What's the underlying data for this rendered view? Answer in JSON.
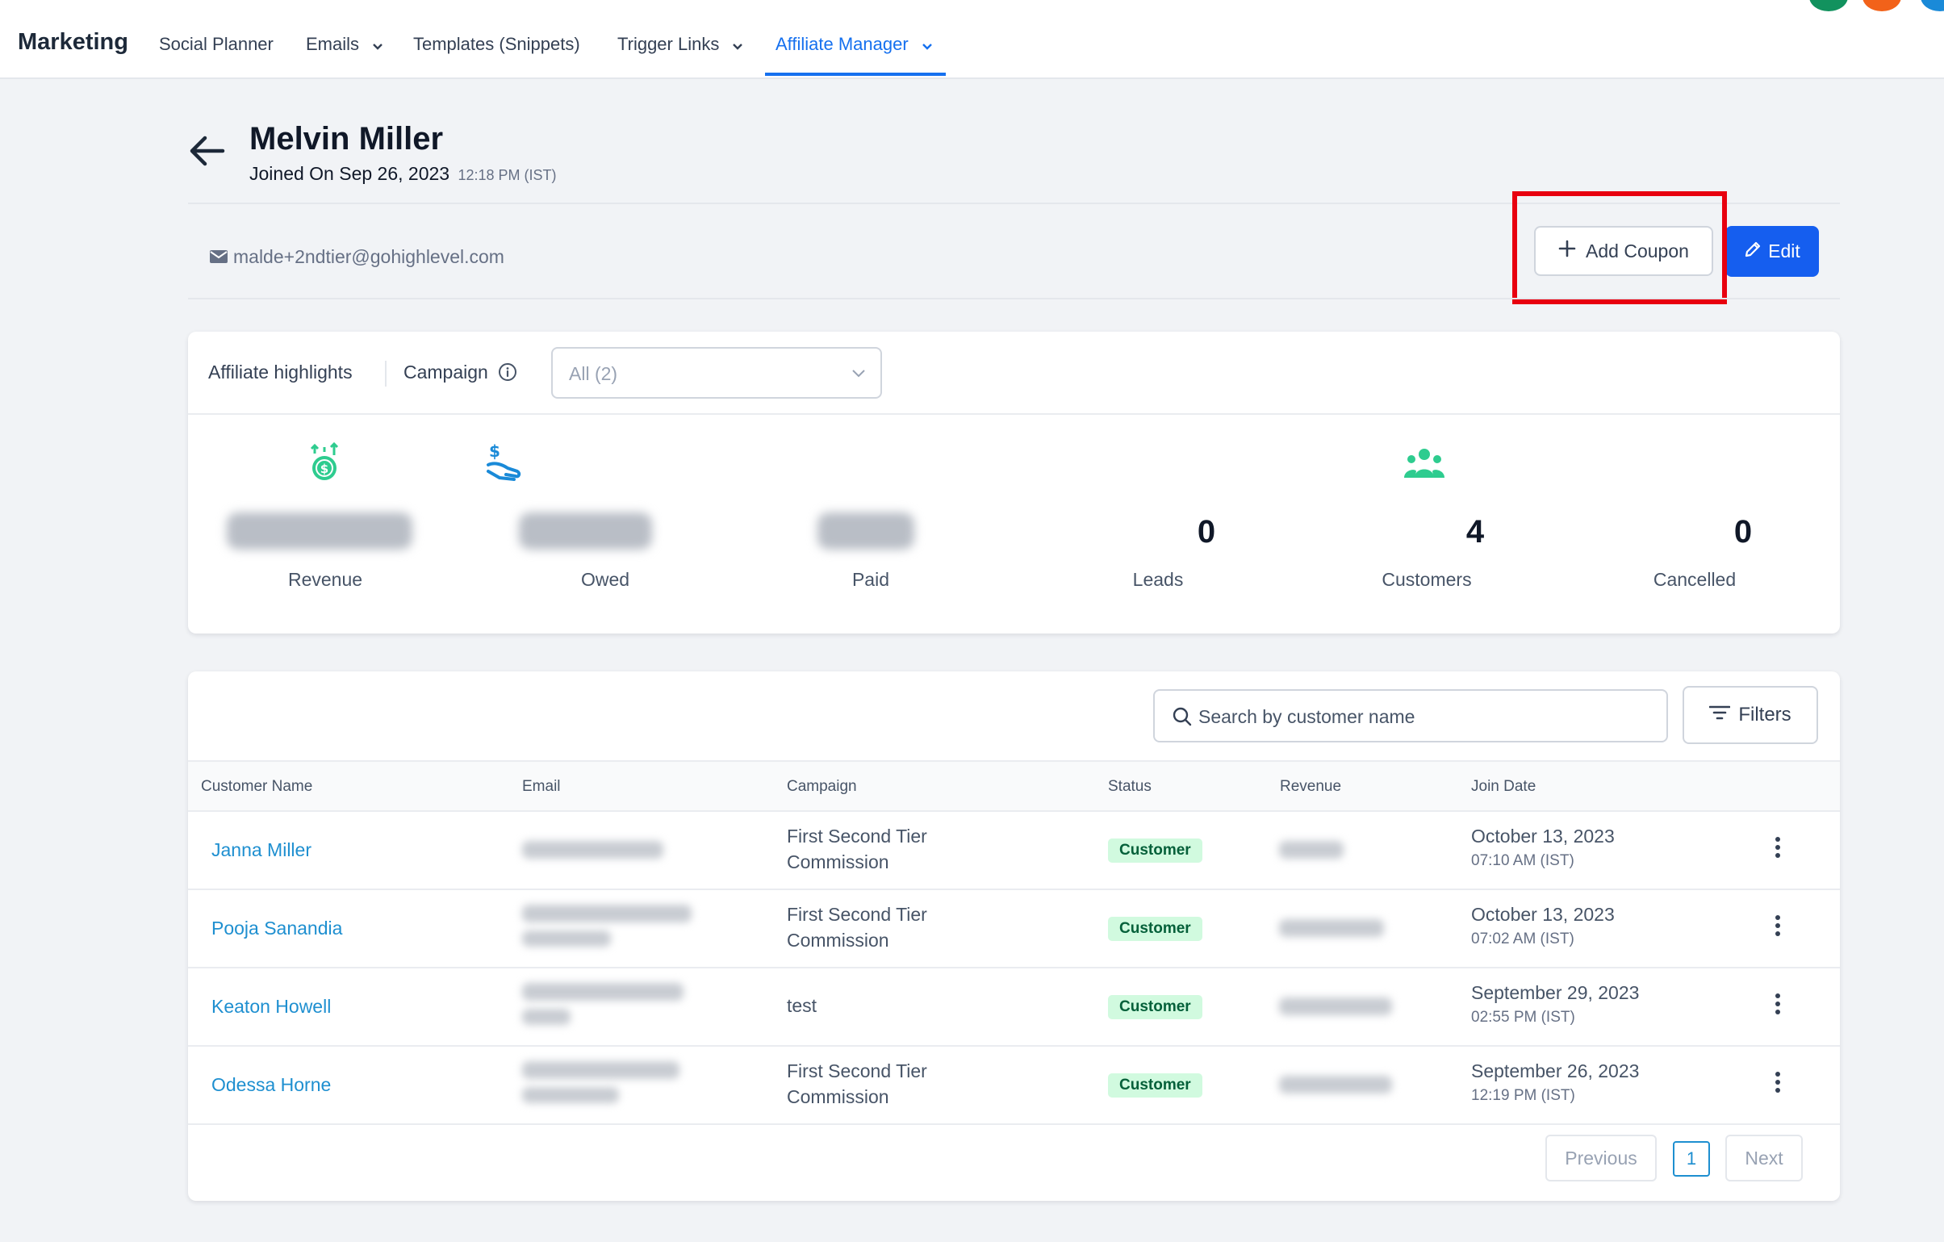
{
  "nav": {
    "brand": "Marketing",
    "items": [
      {
        "label": "Social Planner"
      },
      {
        "label": "Emails"
      },
      {
        "label": "Templates (Snippets)"
      },
      {
        "label": "Trigger Links"
      },
      {
        "label": "Affiliate Manager"
      }
    ]
  },
  "profile": {
    "name": "Melvin Miller",
    "joined_label": "Joined On Sep 26, 2023",
    "joined_time": "12:18 PM (IST)",
    "email": "malde+2ndtier@gohighlevel.com"
  },
  "actions": {
    "add_coupon": "Add Coupon",
    "edit": "Edit"
  },
  "highlights": {
    "title": "Affiliate highlights",
    "campaign_label": "Campaign",
    "campaign_value": "All (2)",
    "stats": [
      {
        "label": "Revenue",
        "value": ""
      },
      {
        "label": "Owed",
        "value": ""
      },
      {
        "label": "Paid",
        "value": ""
      },
      {
        "label": "Leads",
        "value": "0"
      },
      {
        "label": "Customers",
        "value": "4"
      },
      {
        "label": "Cancelled",
        "value": "0"
      }
    ]
  },
  "table": {
    "search_placeholder": "Search by customer name",
    "filters_label": "Filters",
    "columns": [
      "Customer Name",
      "Email",
      "Campaign",
      "Status",
      "Revenue",
      "Join Date"
    ],
    "rows": [
      {
        "name": "Janna Miller",
        "campaign_line1": "First Second Tier",
        "campaign_line2": "Commission",
        "status": "Customer",
        "date": "October 13, 2023",
        "time": "07:10 AM (IST)"
      },
      {
        "name": "Pooja Sanandia",
        "campaign_line1": "First Second Tier",
        "campaign_line2": "Commission",
        "status": "Customer",
        "date": "October 13, 2023",
        "time": "07:02 AM (IST)"
      },
      {
        "name": "Keaton Howell",
        "campaign_line1": "test",
        "campaign_line2": "",
        "status": "Customer",
        "date": "September 29, 2023",
        "time": "02:55 PM (IST)"
      },
      {
        "name": "Odessa Horne",
        "campaign_line1": "First Second Tier",
        "campaign_line2": "Commission",
        "status": "Customer",
        "date": "September 26, 2023",
        "time": "12:19 PM (IST)"
      }
    ],
    "pagination": {
      "previous": "Previous",
      "page": "1",
      "next": "Next"
    }
  },
  "icons": {
    "back": "arrow-left-icon",
    "mail": "mail-icon",
    "plus": "plus-icon",
    "pencil": "pencil-icon",
    "search": "search-icon",
    "filter": "filter-lines-icon"
  },
  "colors": {
    "accent": "#155eef",
    "link": "#1e8fd0",
    "highlight_border": "#e8000f",
    "badge_bg": "#d1fadf",
    "stat_green": "#2ecc8f"
  }
}
